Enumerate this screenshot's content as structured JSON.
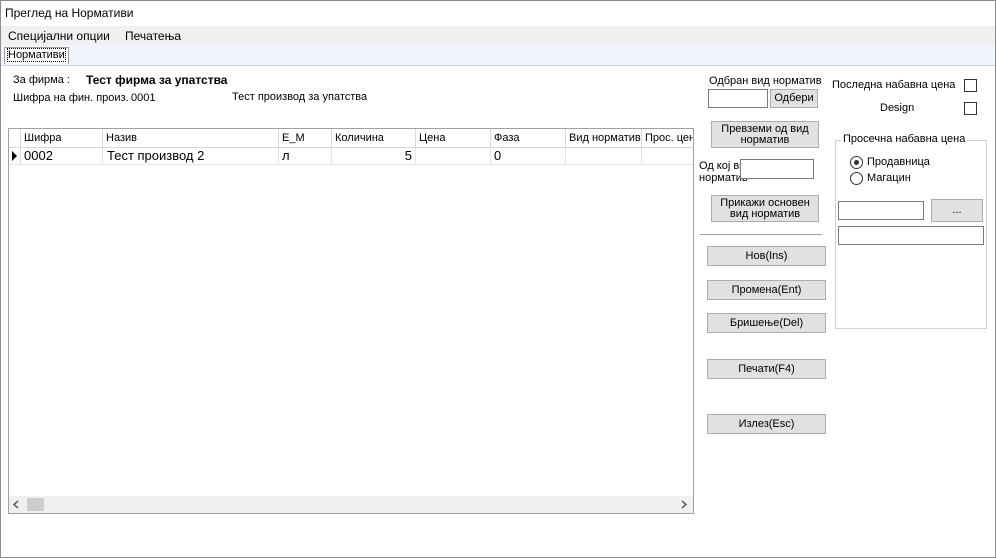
{
  "window": {
    "title": "Преглед на Нормативи"
  },
  "menu": {
    "special_options": "Специјални опции",
    "printing": "Печатења"
  },
  "tabs": {
    "normatives": "Нормативи"
  },
  "header": {
    "firm_label": "За фирма :",
    "firm_value": "Тест фирма за упатства",
    "product_code_label": "Шифра на фин. произ.",
    "product_code_value": "0001",
    "product_name": "Тест производ за упатства"
  },
  "grid": {
    "columns": [
      "Шифра",
      "Назив",
      "Е_М",
      "Количина",
      "Цена",
      "Фаза",
      "Вид норматив",
      "Прос. цена"
    ],
    "rows": [
      {
        "code": "0002",
        "name": "Тест производ 2",
        "unit": "л",
        "quantity": "5",
        "price": "",
        "phase": "0",
        "type": "",
        "avg_price": ""
      }
    ]
  },
  "middle": {
    "chosen_type_label": "Одбран вид норматив",
    "choose_button": "Одбери",
    "take_from_type_button": "Превземи од вид норматив",
    "from_which_type_label": "Од кој вид норматив",
    "show_base_type_button": "Прикажи основен вид норматив",
    "new_button": "Нов(Ins)",
    "change_button": "Промена(Ent)",
    "delete_button": "Бришење(Del)",
    "print_button": "Печати(F4)",
    "exit_button": "Излез(Esc)"
  },
  "right": {
    "last_purchase_price_label": "Последна набавна цена",
    "design_label": "Design",
    "avg_price_group_title": "Просечна набавна цена",
    "store_option": "Продавница",
    "warehouse_option": "Магацин",
    "store_selected": true,
    "ellipsis_button": "..."
  }
}
